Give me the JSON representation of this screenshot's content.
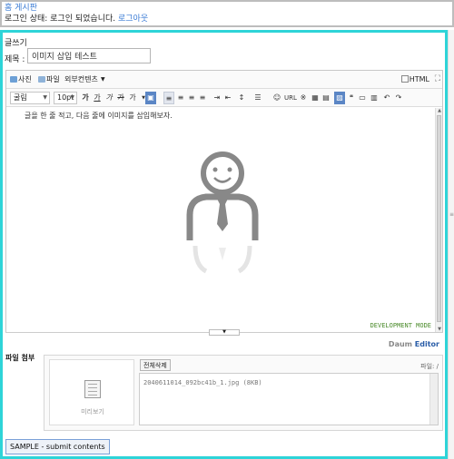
{
  "top": {
    "home_link": "홈 게시판",
    "status_prefix": "로그인 상태: 로그인 되었습니다.",
    "logout_link": "로그아웃"
  },
  "form": {
    "section_heading": "글쓰기",
    "title_label": "제목 :",
    "title_value": "이미지 삽입 테스트"
  },
  "toolbar1": {
    "photo": "사진",
    "file": "파일",
    "external": "외부컨텐츠",
    "html_toggle": "HTML"
  },
  "toolbar2": {
    "font_family": "굴림",
    "font_size": "10pt",
    "buttons": [
      "가",
      "가",
      "가",
      "가",
      "가"
    ],
    "url": "URL"
  },
  "editor": {
    "body_text": "글을 한 줄 적고, 다음 줄에 이미지를 삽입해보자.",
    "mode_text": "DEVELOPMENT MODE"
  },
  "brand": {
    "daum": "Daum",
    "editor": "Editor"
  },
  "attach": {
    "label": "파일 첨부",
    "preview_label": "미리보기",
    "delete_all": "전체삭제",
    "file_info": "파일: /",
    "files": [
      "2040611014_092bc41b_1.jpg (8KB)"
    ]
  },
  "submit_label": "SAMPLE - submit contents"
}
